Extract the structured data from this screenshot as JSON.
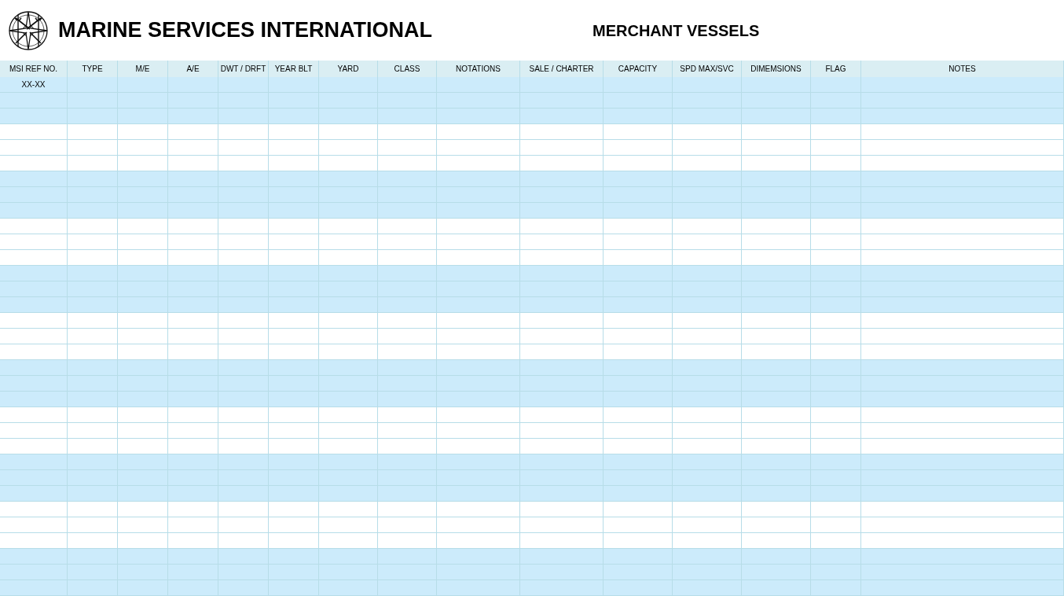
{
  "header": {
    "company": "MARINE SERVICES INTERNATIONAL",
    "title": "MERCHANT VESSELS"
  },
  "table": {
    "columns": [
      "MSI REF NO.",
      "TYPE",
      "M/E",
      "A/E",
      "DWT / DRFT",
      "YEAR BLT",
      "YARD",
      "CLASS",
      "NOTATIONS",
      "SALE / CHARTER",
      "CAPACITY",
      "SPD MAX/SVC",
      "DIMEMSIONS",
      "FLAG",
      "NOTES"
    ],
    "rows": [
      {
        "shaded": true,
        "cells": [
          "XX-XX"
        ]
      },
      {
        "shaded": true
      },
      {
        "shaded": true
      },
      {
        "shaded": false
      },
      {
        "shaded": false
      },
      {
        "shaded": false
      },
      {
        "shaded": true
      },
      {
        "shaded": true
      },
      {
        "shaded": true
      },
      {
        "shaded": false
      },
      {
        "shaded": false
      },
      {
        "shaded": false
      },
      {
        "shaded": true
      },
      {
        "shaded": true
      },
      {
        "shaded": true
      },
      {
        "shaded": false
      },
      {
        "shaded": false
      },
      {
        "shaded": false
      },
      {
        "shaded": true
      },
      {
        "shaded": true
      },
      {
        "shaded": true
      },
      {
        "shaded": false
      },
      {
        "shaded": false
      },
      {
        "shaded": false
      },
      {
        "shaded": true
      },
      {
        "shaded": true
      },
      {
        "shaded": true
      },
      {
        "shaded": false
      },
      {
        "shaded": false
      },
      {
        "shaded": false
      },
      {
        "shaded": true
      },
      {
        "shaded": true
      },
      {
        "shaded": true
      }
    ]
  }
}
